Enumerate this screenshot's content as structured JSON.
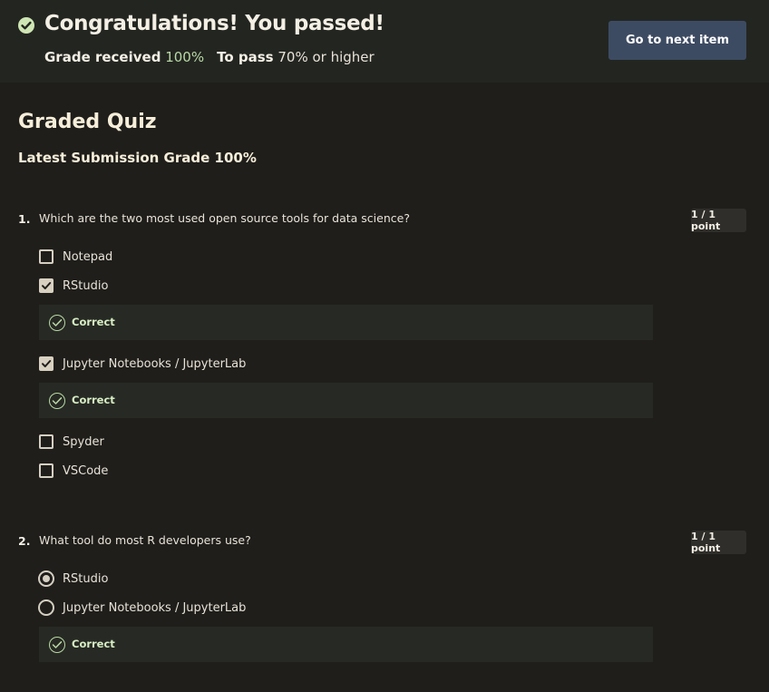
{
  "banner": {
    "title": "Congratulations! You passed!",
    "grade_received_label": "Grade received",
    "grade_received_value": "100%",
    "to_pass_label": "To pass",
    "to_pass_value": "70% or higher",
    "next_button": "Go to next item"
  },
  "quiz": {
    "title": "Graded Quiz",
    "latest_grade": "Latest Submission Grade 100%"
  },
  "questions": [
    {
      "number": "1.",
      "text": "Which are the two most used open source tools for data science?",
      "points": "1 / 1 point",
      "options": [
        {
          "label": "Notepad",
          "checked": false
        },
        {
          "label": "RStudio",
          "checked": true,
          "feedback": "Correct"
        },
        {
          "label": "Jupyter Notebooks / JupyterLab",
          "checked": true,
          "feedback": "Correct"
        },
        {
          "label": "Spyder",
          "checked": false
        },
        {
          "label": "VSCode",
          "checked": false
        }
      ]
    },
    {
      "number": "2.",
      "text": "What tool do most R developers use?",
      "points": "1 / 1 point",
      "options": [
        {
          "label": "RStudio",
          "checked": true
        },
        {
          "label": "Jupyter Notebooks / JupyterLab",
          "checked": false
        }
      ],
      "feedback": "Correct"
    }
  ],
  "colors": {
    "background": "#1f1e1b",
    "banner": "#232521",
    "button": "#3d4b62",
    "success": "#b9d8a4"
  },
  "icons": {
    "banner": "check-circle-icon",
    "feedback": "check-circle-outline-icon"
  }
}
